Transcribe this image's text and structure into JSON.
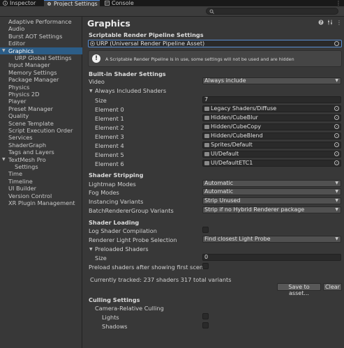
{
  "tabs": [
    {
      "label": "Inspector",
      "icon": "info-icon",
      "active": false
    },
    {
      "label": "Project Settings",
      "icon": "gear-icon",
      "active": true
    },
    {
      "label": "Console",
      "icon": "console-icon",
      "active": false
    }
  ],
  "search": {
    "placeholder": ""
  },
  "sidebar": {
    "items": [
      {
        "label": "Adaptive Performance"
      },
      {
        "label": "Audio"
      },
      {
        "label": "Burst AOT Settings"
      },
      {
        "label": "Editor"
      },
      {
        "label": "Graphics",
        "selected": true,
        "expanded": true
      },
      {
        "label": "URP Global Settings",
        "child": true
      },
      {
        "label": "Input Manager"
      },
      {
        "label": "Memory Settings"
      },
      {
        "label": "Package Manager"
      },
      {
        "label": "Physics"
      },
      {
        "label": "Physics 2D"
      },
      {
        "label": "Player"
      },
      {
        "label": "Preset Manager"
      },
      {
        "label": "Quality"
      },
      {
        "label": "Scene Template"
      },
      {
        "label": "Script Execution Order"
      },
      {
        "label": "Services"
      },
      {
        "label": "ShaderGraph"
      },
      {
        "label": "Tags and Layers"
      },
      {
        "label": "TextMesh Pro",
        "expanded": true
      },
      {
        "label": "Settings",
        "child": true
      },
      {
        "label": "Time"
      },
      {
        "label": "Timeline"
      },
      {
        "label": "UI Builder"
      },
      {
        "label": "Version Control"
      },
      {
        "label": "XR Plugin Management"
      }
    ]
  },
  "main": {
    "title": "Graphics",
    "srp": {
      "section": "Scriptable Render Pipeline Settings",
      "value": "URP (Universal Render Pipeline Asset)",
      "help": "A Scriptable Render Pipeline is in use, some settings will not be used and are hidden"
    },
    "builtin": {
      "section": "Built-in Shader Settings",
      "video_label": "Video",
      "video_value": "Always include",
      "always_included_label": "Always Included Shaders",
      "size_label": "Size",
      "size_value": "7",
      "elements": [
        {
          "label": "Element 0",
          "value": "Legacy Shaders/Diffuse"
        },
        {
          "label": "Element 1",
          "value": "Hidden/CubeBlur"
        },
        {
          "label": "Element 2",
          "value": "Hidden/CubeCopy"
        },
        {
          "label": "Element 3",
          "value": "Hidden/CubeBlend"
        },
        {
          "label": "Element 4",
          "value": "Sprites/Default"
        },
        {
          "label": "Element 5",
          "value": "UI/Default"
        },
        {
          "label": "Element 6",
          "value": "UI/DefaultETC1"
        }
      ]
    },
    "stripping": {
      "section": "Shader Stripping",
      "rows": [
        {
          "label": "Lightmap Modes",
          "value": "Automatic"
        },
        {
          "label": "Fog Modes",
          "value": "Automatic"
        },
        {
          "label": "Instancing Variants",
          "value": "Strip Unused"
        },
        {
          "label": "BatchRendererGroup Variants",
          "value": "Strip if no Hybrid Renderer package"
        }
      ]
    },
    "loading": {
      "section": "Shader Loading",
      "log_label": "Log Shader Compilation",
      "probe_label": "Renderer Light Probe Selection",
      "probe_value": "Find closest Light Probe",
      "preloaded_label": "Preloaded Shaders",
      "size_label": "Size",
      "size_value": "0",
      "preload_after_label": "Preload shaders after showing first scene",
      "tracked": "Currently tracked: 237 shaders 317 total variants",
      "save_button": "Save to asset...",
      "clear_button": "Clear"
    },
    "culling": {
      "section": "Culling Settings",
      "camera_label": "Camera-Relative Culling",
      "lights_label": "Lights",
      "shadows_label": "Shadows"
    }
  }
}
